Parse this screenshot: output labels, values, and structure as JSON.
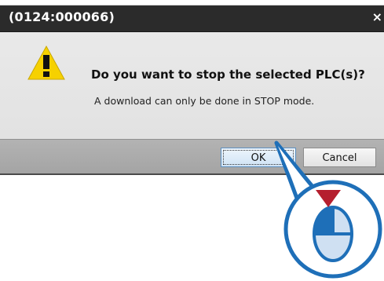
{
  "dialog": {
    "title": "(0124:000066)",
    "close_glyph": "×",
    "icon": "warning-icon",
    "question": "Do you want to stop the selected PLC(s)?",
    "info": "A download can only be done in STOP mode.",
    "buttons": {
      "ok": "OK",
      "cancel": "Cancel"
    }
  },
  "callout": {
    "icon": "mouse-left-click-icon",
    "accent": "#1e6fb8",
    "arrow_color": "#b51f2e"
  },
  "colors": {
    "titlebar": "#2b2b2b",
    "warning": "#f6d100"
  }
}
